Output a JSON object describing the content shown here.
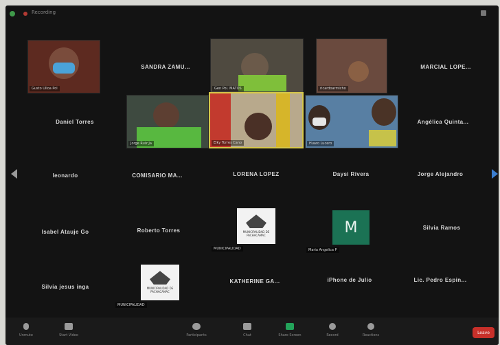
{
  "window": {
    "recording_label": "Recording",
    "dot_colors": [
      "#3f9a4a",
      "#b33a33"
    ]
  },
  "gallery": {
    "row1": [
      {
        "label": "Gusto Ulloa Pol"
      },
      {
        "name": "SANDRA ZAMU..."
      },
      {
        "label": "Gen Pol. MATOS"
      },
      {
        "label": "ricardoarmicho"
      },
      {
        "name": "MARCIAL LOPE..."
      }
    ],
    "row2": [
      {
        "name": "Daniel Torres"
      },
      {
        "label": "Jorge Ruiz Ja"
      },
      {
        "label": "Elky Torres Cano"
      },
      {
        "label": "Huaro Lucero"
      },
      {
        "name": "Angélica Quinta..."
      }
    ],
    "row3": [
      {
        "name": "leonardo"
      },
      {
        "name": "COMISARIO MA..."
      },
      {
        "name": "LORENA LOPEZ"
      },
      {
        "name": "Daysi Rivera"
      },
      {
        "name": "Jorge Alejandro"
      }
    ],
    "row4": [
      {
        "name": "Isabel Atauje Go"
      },
      {
        "name": "Roberto Torres"
      },
      {
        "label": "MUNICIPALIDAD",
        "logo_text": "MUNICIPALIDAD DE PACHACAMAC"
      },
      {
        "initial": "M",
        "label": "Maria Angelica P"
      },
      {
        "name": "Silvia Ramos"
      }
    ],
    "row5": [
      {
        "name": "Silvia jesus inga"
      },
      {
        "label": "MUNICIPALIDAD",
        "logo_text": "MUNICIPALIDAD DE PACHACAMAC"
      },
      {
        "name": "KATHERINE GA..."
      },
      {
        "name": "iPhone de Julio"
      },
      {
        "name": "Lic. Pedro Espin..."
      }
    ]
  },
  "toolbar": {
    "unmute": "Unmute",
    "start_video": "Start Video",
    "participants": "Participants",
    "chat": "Chat",
    "share_screen": "Share Screen",
    "record": "Record",
    "reactions": "Reactions",
    "leave": "Leave"
  },
  "colors": {
    "active_speaker": "#d6c74a",
    "share_green": "#23a35a",
    "leave_red": "#c8302a",
    "nav_arrow": "#3c7fd1"
  }
}
